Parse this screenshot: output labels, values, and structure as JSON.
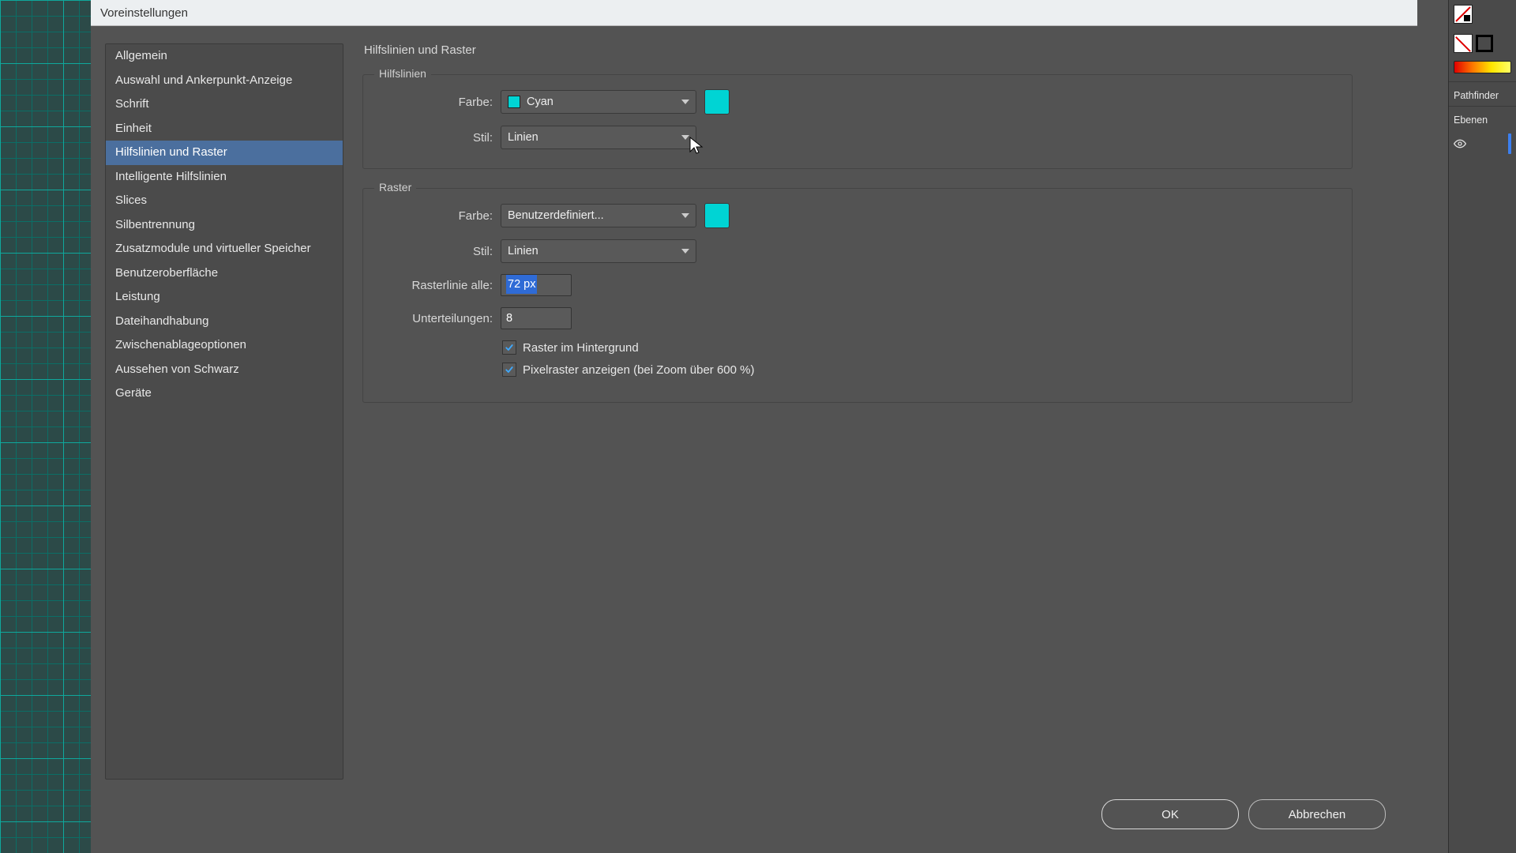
{
  "dialog": {
    "title": "Voreinstellungen",
    "ok": "OK",
    "cancel": "Abbrechen"
  },
  "sidebar": {
    "items": [
      "Allgemein",
      "Auswahl und Ankerpunkt-Anzeige",
      "Schrift",
      "Einheit",
      "Hilfslinien und Raster",
      "Intelligente Hilfslinien",
      "Slices",
      "Silbentrennung",
      "Zusatzmodule und virtueller Speicher",
      "Benutzeroberfläche",
      "Leistung",
      "Dateihandhabung",
      "Zwischenablageoptionen",
      "Aussehen von Schwarz",
      "Geräte"
    ],
    "selectedIndex": 4
  },
  "page": {
    "heading": "Hilfslinien und Raster"
  },
  "guides": {
    "legend": "Hilfslinien",
    "color_label": "Farbe:",
    "color_value": "Cyan",
    "color_hex": "#00d4d4",
    "style_label": "Stil:",
    "style_value": "Linien"
  },
  "grid": {
    "legend": "Raster",
    "color_label": "Farbe:",
    "color_value": "Benutzerdefiniert...",
    "color_hex": "#00d4d4",
    "style_label": "Stil:",
    "style_value": "Linien",
    "gridline_label": "Rasterlinie alle:",
    "gridline_value": "72 px",
    "subdiv_label": "Unterteilungen:",
    "subdiv_value": "8",
    "back_label": "Raster im Hintergrund",
    "back_checked": true,
    "pixel_label": "Pixelraster anzeigen (bei Zoom über 600 %)",
    "pixel_checked": true
  },
  "panels": {
    "pathfinder": "Pathfinder",
    "layers": "Ebenen"
  }
}
